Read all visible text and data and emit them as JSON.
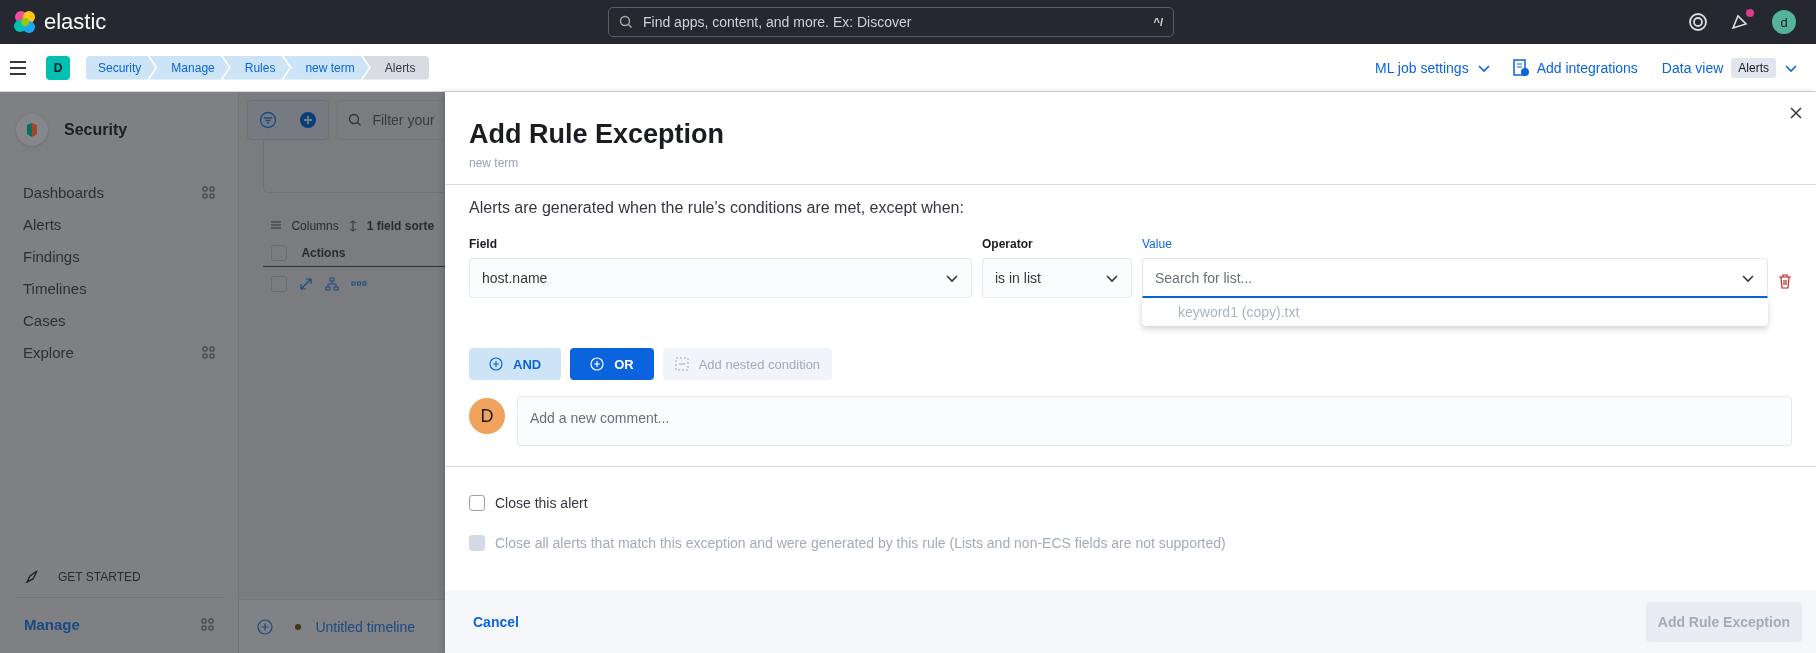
{
  "header": {
    "logo_text": "elastic",
    "search_placeholder": "Find apps, content, and more. Ex: Discover",
    "shortcut": "^/",
    "avatar": "d",
    "notification": true
  },
  "nav": {
    "space_badge": "D",
    "breadcrumbs": [
      {
        "label": "Security",
        "selected": false
      },
      {
        "label": "Manage",
        "selected": false
      },
      {
        "label": "Rules",
        "selected": false
      },
      {
        "label": "new term",
        "selected": false
      },
      {
        "label": "Alerts",
        "selected": true
      }
    ],
    "ml_job_settings": "ML job settings",
    "add_integrations": "Add integrations",
    "data_view_label": "Data view",
    "data_view_badge": "Alerts"
  },
  "sidebar": {
    "title": "Security",
    "items": [
      {
        "label": "Dashboards",
        "launcher": true
      },
      {
        "label": "Alerts",
        "launcher": false
      },
      {
        "label": "Findings",
        "launcher": false
      },
      {
        "label": "Timelines",
        "launcher": false
      },
      {
        "label": "Cases",
        "launcher": false
      },
      {
        "label": "Explore",
        "launcher": true
      }
    ],
    "get_started": "GET STARTED",
    "manage": "Manage"
  },
  "background": {
    "filter_placeholder": "Filter your",
    "header_checked": false,
    "row_checked": false,
    "columns_label": "Columns",
    "sort_label": "1 field sorte",
    "actions_header": "Actions",
    "timeline": "Untitled timeline"
  },
  "flyout": {
    "title": "Add Rule Exception",
    "subtitle": "new term",
    "description": "Alerts are generated when the rule's conditions are met, except when:",
    "field": {
      "label": "Field",
      "value": "host.name"
    },
    "operator": {
      "label": "Operator",
      "value": "is in list"
    },
    "value": {
      "label": "Value",
      "placeholder": "Search for list...",
      "focused": true
    },
    "options": [
      "keyword1 (copy).txt"
    ],
    "buttons": [
      {
        "label": "AND",
        "kind": "and",
        "disabled": false
      },
      {
        "label": "OR",
        "kind": "or",
        "disabled": false
      },
      {
        "label": "Add nested condition",
        "kind": "nested",
        "disabled": true
      }
    ],
    "comment": {
      "avatar": "D",
      "placeholder": "Add a new comment..."
    },
    "checkboxes": [
      {
        "label": "Close this alert",
        "checked": false,
        "disabled": false
      },
      {
        "label": "Close all alerts that match this exception and were generated by this rule (Lists and non-ECS fields are not supported)",
        "checked": false,
        "disabled": true
      }
    ],
    "cancel": "Cancel",
    "submit": {
      "label": "Add Rule Exception",
      "disabled": true
    }
  }
}
